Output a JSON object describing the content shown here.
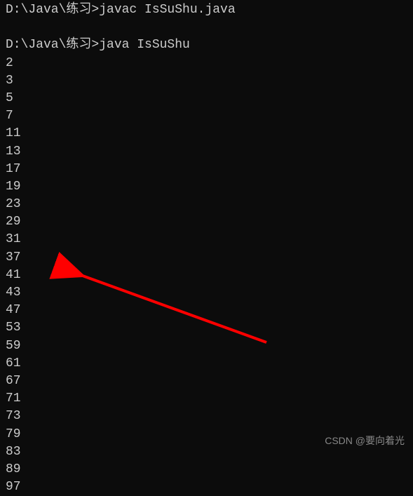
{
  "terminal": {
    "line1": {
      "prompt": "D:\\Java\\练习>",
      "command": "javac IsSuShu.java"
    },
    "line2": {
      "prompt": "D:\\Java\\练习>",
      "command": "java IsSuShu"
    },
    "output": [
      "2",
      "3",
      "5",
      "7",
      "11",
      "13",
      "17",
      "19",
      "23",
      "29",
      "31",
      "37",
      "41",
      "43",
      "47",
      "53",
      "59",
      "61",
      "67",
      "71",
      "73",
      "79",
      "83",
      "89",
      "97"
    ]
  },
  "annotation": {
    "arrow_color": "#ff0000"
  },
  "watermark": {
    "text": "CSDN @要向着光"
  }
}
